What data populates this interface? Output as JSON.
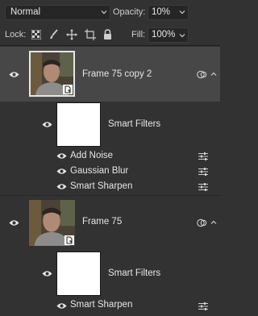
{
  "toolbar": {
    "blend_mode": "Normal",
    "opacity_label": "Opacity:",
    "opacity_value": "10%",
    "lock_label": "Lock:",
    "fill_label": "Fill:",
    "fill_value": "100%"
  },
  "layers": [
    {
      "name": "Frame 75 copy 2",
      "selected": true,
      "smart_filters_label": "Smart Filters",
      "filters": [
        "Add Noise",
        "Gaussian Blur",
        "Smart Sharpen"
      ]
    },
    {
      "name": "Frame 75",
      "selected": false,
      "smart_filters_label": "Smart Filters",
      "filters": [
        "Smart Sharpen"
      ]
    }
  ],
  "icons": {
    "eye": "eye-icon",
    "lock_pixels": "checkerboard-lock-icon",
    "lock_paint": "brush-lock-icon",
    "lock_move": "move-lock-icon",
    "lock_artboard": "artboard-lock-icon",
    "lock_all": "padlock-icon",
    "smart_object": "smart-object-badge-icon",
    "filter_options": "sliders-icon",
    "link": "link-rings-icon"
  },
  "colors": {
    "panel_bg": "#323232",
    "selected_row": "#474747",
    "field_bg": "#262626",
    "text": "#e6e6e6"
  }
}
